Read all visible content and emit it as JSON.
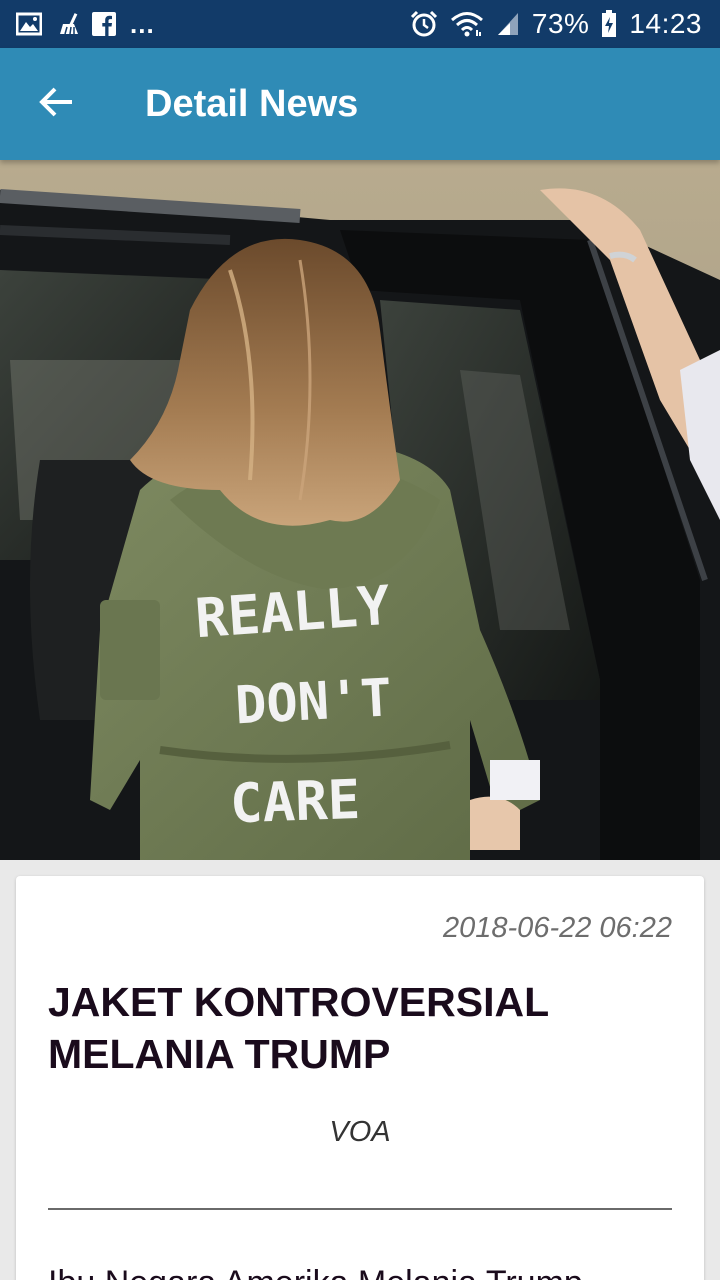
{
  "status_bar": {
    "icons_left": [
      "image-icon",
      "broom-icon",
      "facebook-icon"
    ],
    "more": "...",
    "icons_right": [
      "alarm-icon",
      "wifi-icon",
      "cell-signal-icon",
      "battery-icon"
    ],
    "battery": "73%",
    "time": "14:23",
    "colors": {
      "background": "#123b69"
    }
  },
  "app_bar": {
    "title": "Detail News",
    "back_icon": "arrow-left-icon",
    "colors": {
      "background": "#2f8bb6"
    }
  },
  "article": {
    "date": "2018-06-22 06:22",
    "title": "JAKET KONTROVERSIAL MELANIA TRUMP",
    "source": "VOA",
    "body_preview": "Ibu Negara Amerika Melania Trump"
  },
  "colors": {
    "page_background": "#e9e9e9",
    "headline": "#1a0b1c",
    "meta_text": "#6d6d6d"
  }
}
